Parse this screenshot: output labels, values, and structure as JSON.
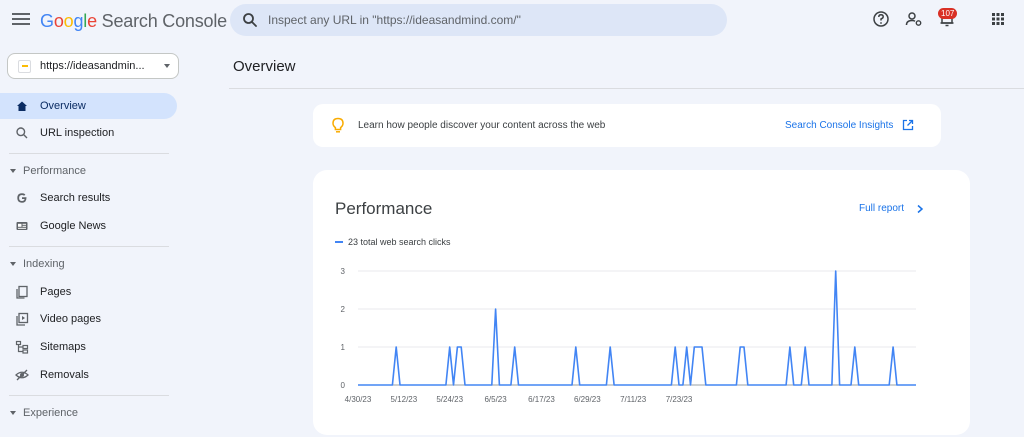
{
  "app": {
    "brand_google": [
      "G",
      "o",
      "o",
      "g",
      "l",
      "e"
    ],
    "brand_rest": " Search Console",
    "search_placeholder": "Inspect any URL in \"https://ideasandmind.com/\"",
    "notifications_count": "107"
  },
  "sidebar": {
    "property_label": "https://ideasandmin...",
    "items": [
      {
        "label": "Overview",
        "icon": "home-icon",
        "active": true
      },
      {
        "label": "URL inspection",
        "icon": "search-icon"
      }
    ],
    "sections": [
      {
        "label": "Performance",
        "items": [
          {
            "label": "Search results",
            "icon": "google-g-icon"
          },
          {
            "label": "Google News",
            "icon": "news-icon"
          }
        ]
      },
      {
        "label": "Indexing",
        "items": [
          {
            "label": "Pages",
            "icon": "pages-icon"
          },
          {
            "label": "Video pages",
            "icon": "video-pages-icon"
          },
          {
            "label": "Sitemaps",
            "icon": "sitemap-icon"
          },
          {
            "label": "Removals",
            "icon": "removals-icon"
          }
        ]
      },
      {
        "label": "Experience",
        "items": []
      }
    ]
  },
  "main": {
    "title": "Overview",
    "insight": {
      "message": "Learn how people discover your content across the web",
      "link": "Search Console Insights"
    },
    "performance": {
      "title": "Performance",
      "full_report": "Full report",
      "legend": "23 total web search clicks"
    }
  },
  "colors": {
    "accent": "#1a73e8",
    "series": "#4285f4",
    "active_nav": "#d3e3fd",
    "background": "#f1f4fb"
  },
  "chart_data": {
    "type": "line",
    "x_tick_labels": [
      "4/30/23",
      "5/12/23",
      "5/24/23",
      "6/5/23",
      "6/17/23",
      "6/29/23",
      "7/11/23",
      "7/23/23"
    ],
    "y_tick_labels": [
      "0",
      "1",
      "2",
      "3"
    ],
    "ylim": [
      0,
      3
    ],
    "grid": true,
    "x_start": "4/30/23",
    "series": [
      {
        "name": "23 total web search clicks",
        "values": [
          0,
          0,
          0,
          0,
          0,
          0,
          0,
          0,
          0,
          0,
          1,
          0,
          0,
          0,
          0,
          0,
          0,
          0,
          0,
          0,
          0,
          0,
          0,
          0,
          1,
          0,
          1,
          1,
          0,
          0,
          0,
          0,
          0,
          0,
          0,
          0,
          2,
          0,
          0,
          0,
          0,
          1,
          0,
          0,
          0,
          0,
          0,
          0,
          0,
          0,
          0,
          0,
          0,
          0,
          0,
          0,
          0,
          1,
          0,
          0,
          0,
          0,
          0,
          0,
          0,
          0,
          1,
          0,
          0,
          0,
          0,
          0,
          0,
          0,
          0,
          0,
          0,
          0,
          0,
          0,
          0,
          0,
          0,
          1,
          0,
          0,
          1,
          0,
          1,
          1,
          1,
          0,
          0,
          0,
          0,
          0,
          0,
          0,
          0,
          0,
          1,
          1,
          0,
          0,
          0,
          0,
          0,
          0,
          0,
          0,
          0,
          0,
          0,
          1,
          0,
          0,
          0,
          1,
          0,
          0,
          0,
          0,
          0,
          0,
          0,
          3,
          0,
          0,
          0,
          0,
          1,
          0,
          0,
          0,
          0,
          0,
          0,
          0,
          0,
          0,
          1,
          0,
          0,
          0,
          0,
          0,
          0
        ]
      }
    ]
  }
}
